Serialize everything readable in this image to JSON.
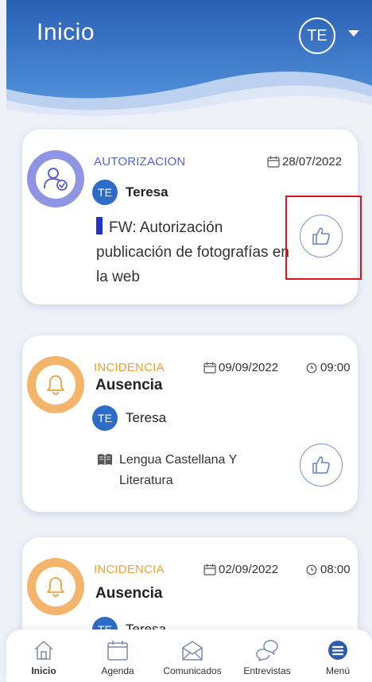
{
  "header": {
    "title": "Inicio",
    "user_initials": "TE"
  },
  "cards": [
    {
      "category": "AUTORIZACION",
      "date": "28/07/2022",
      "person_initials": "TE",
      "person_name": "Teresa",
      "subject": "FW: Autorización publicación de fotografías en la web",
      "icon": "user-check-icon"
    },
    {
      "category": "INCIDENCIA",
      "date": "09/09/2022",
      "time": "09:00",
      "title": "Ausencia",
      "person_initials": "TE",
      "person_name": "Teresa",
      "course": "Lengua Castellana Y Literatura",
      "icon": "bell-icon"
    },
    {
      "category": "INCIDENCIA",
      "date": "02/09/2022",
      "time": "08:00",
      "title": "Ausencia",
      "person_initials": "TE",
      "person_name": "Teresa",
      "icon": "bell-icon"
    }
  ],
  "nav": {
    "items": [
      {
        "label": "Inicio",
        "icon": "home-icon"
      },
      {
        "label": "Agenda",
        "icon": "calendar-icon"
      },
      {
        "label": "Comunicados",
        "icon": "envelope-icon"
      },
      {
        "label": "Entrevistas",
        "icon": "chat-icon"
      },
      {
        "label": "Menú",
        "icon": "menu-icon"
      }
    ],
    "active": "Inicio"
  },
  "colors": {
    "header_blue": "#2e6bc6",
    "authorization_purple": "#5a5fd6",
    "incident_orange": "#f0a035",
    "highlight_red": "#e0121b"
  }
}
